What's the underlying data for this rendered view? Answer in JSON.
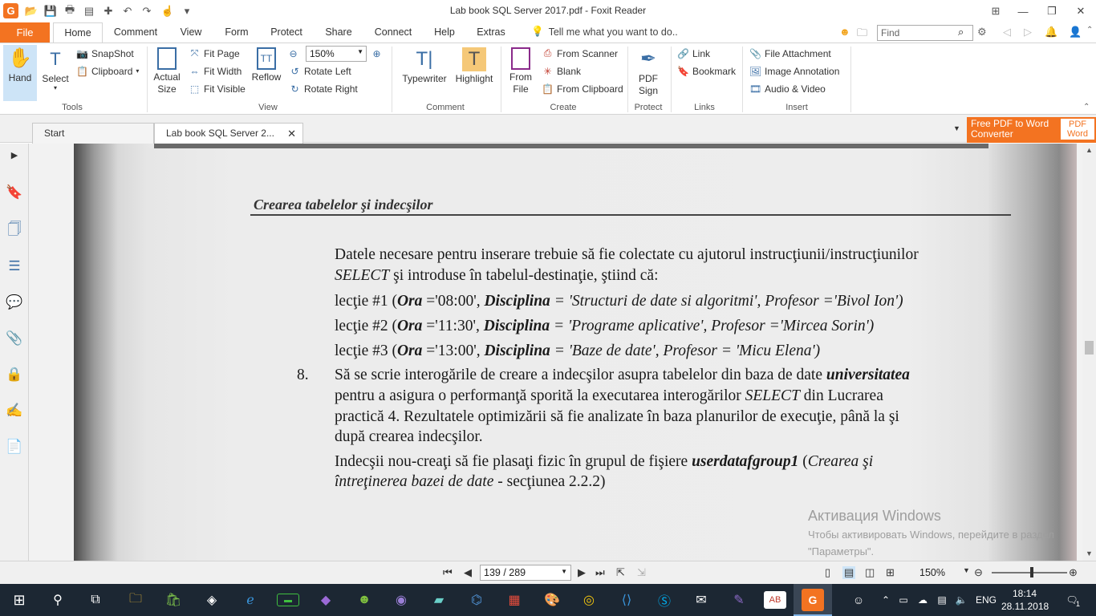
{
  "window": {
    "title": "Lab book SQL Server 2017.pdf - Foxit Reader",
    "logo": "G",
    "minimize": "—",
    "restore": "❐",
    "close": "✕"
  },
  "menu": {
    "file": "File",
    "tabs": [
      "Home",
      "Comment",
      "View",
      "Form",
      "Protect",
      "Share",
      "Connect",
      "Help",
      "Extras"
    ],
    "tellme": "Tell me what you want to do..",
    "find_placeholder": "Find"
  },
  "ribbon": {
    "tools": {
      "hand": "Hand",
      "select": "Select",
      "snapshot": "SnapShot",
      "clipboard": "Clipboard",
      "label": "Tools"
    },
    "view": {
      "actual_size": "Actual Size",
      "fit_page": "Fit Page",
      "fit_width": "Fit Width",
      "fit_visible": "Fit Visible",
      "reflow": "Reflow",
      "zoom": "150%",
      "rotate_left": "Rotate Left",
      "rotate_right": "Rotate Right",
      "label": "View"
    },
    "comment": {
      "typewriter": "Typewriter",
      "highlight": "Highlight",
      "label": "Comment"
    },
    "create": {
      "from_file": "From File",
      "from_scanner": "From Scanner",
      "blank": "Blank",
      "from_clipboard": "From Clipboard",
      "label": "Create"
    },
    "protect": {
      "pdf_sign": "PDF Sign",
      "label": "Protect"
    },
    "links": {
      "link": "Link",
      "bookmark": "Bookmark",
      "label": "Links"
    },
    "insert": {
      "file_attachment": "File Attachment",
      "image_annotation": "Image Annotation",
      "audio_video": "Audio & Video",
      "label": "Insert"
    }
  },
  "tabs": {
    "start": "Start",
    "document": "Lab book SQL Server 2...",
    "promo_line1": "Free PDF to Word",
    "promo_line2": "Converter",
    "promo_badge1": "PDF",
    "promo_badge2": "Word"
  },
  "document": {
    "header": "Crearea tabelelor şi indecşilor",
    "p1_line1": "Datele necesare pentru inserare trebuie să fie colectate cu ajutorul instrucţiunii/instrucţiunilor",
    "p1_line2_a": "SELECT",
    "p1_line2_b": " şi introduse în tabelul-destinaţie, ştiind că:",
    "lectie1_a": "lecţie #1 (",
    "lectie1_b": "Ora",
    "lectie1_c": " ='08:00', ",
    "lectie1_d": "Disciplina",
    "lectie1_e": " = 'Structuri de date si algoritmi', Profesor ='Bivol Ion')",
    "lectie2_a": "lecţie #2 (",
    "lectie2_b": "Ora",
    "lectie2_c": " ='11:30', ",
    "lectie2_d": "Disciplina",
    "lectie2_e": " = 'Programe aplicative', Profesor ='Mircea Sorin')",
    "lectie3_a": "lecţie #3 (",
    "lectie3_b": "Ora",
    "lectie3_c": " ='13:00', ",
    "lectie3_d": "Disciplina",
    "lectie3_e": " = 'Baze de date', Profesor = 'Micu Elena')",
    "item_number": "8.",
    "p8_line1_a": "Să se scrie interogările de creare a indecşilor asupra tabelelor din baza de date ",
    "p8_line1_b": "universitatea",
    "p8_line2_a": "pentru a asigura o performanţă sporită la executarea interogărilor ",
    "p8_line2_b": "SELECT",
    "p8_line2_c": " din Lucrarea",
    "p8_line3": "practică 4. Rezultatele optimizării să fie analizate în baza planurilor de execuţie, până la şi",
    "p8_line4": "după crearea indecşilor.",
    "p9_line1_a": "Indecşii nou-creaţi să fie plasaţi fizic în grupul de fişiere ",
    "p9_line1_b": "userdatafgroup1",
    "p9_line1_c": " (",
    "p9_line1_d": "Crearea şi",
    "p9_line2_a": "întreţinerea bazei de date",
    "p9_line2_b": " - secţiunea 2.2.2)"
  },
  "activation": {
    "title": "Активация Windows",
    "text": "Чтобы активировать Windows, перейдите в раздел \"Параметры\"."
  },
  "status": {
    "page": "139 / 289",
    "zoom": "150%"
  },
  "taskbar": {
    "lang": "ENG",
    "time": "18:14",
    "date": "28.11.2018",
    "notifications": "1"
  },
  "colors": {
    "accent": "#f37321",
    "ribbon_active": "#cde4f7",
    "taskbar": "#1c2733"
  }
}
